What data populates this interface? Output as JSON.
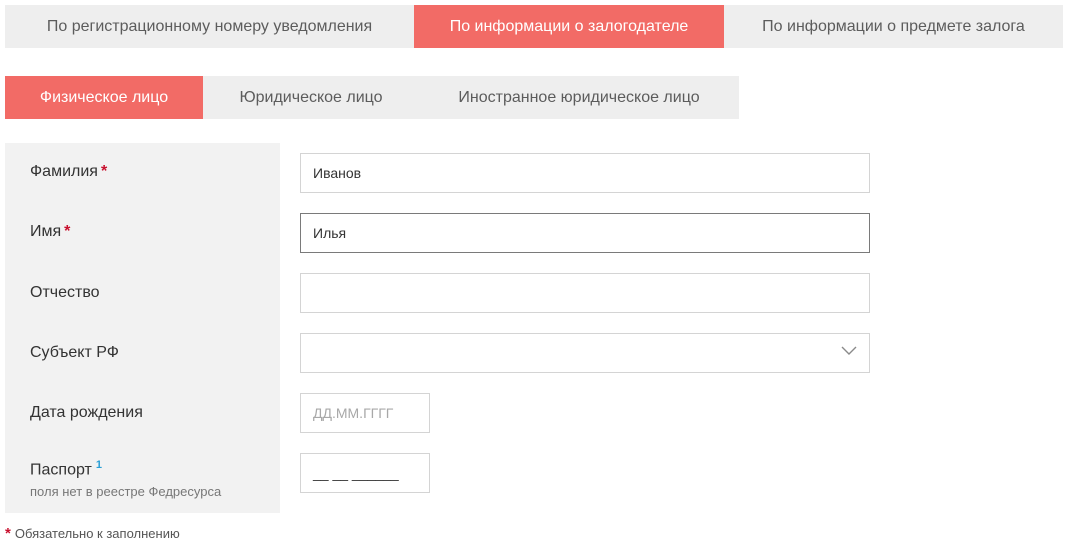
{
  "tabs_top": [
    {
      "label": "По регистрационному номеру уведомления",
      "active": false
    },
    {
      "label": "По информации о залогодателе",
      "active": true
    },
    {
      "label": "По информации о предмете залога",
      "active": false
    }
  ],
  "tabs_sub": [
    {
      "label": "Физическое лицо",
      "active": true
    },
    {
      "label": "Юридическое лицо",
      "active": false
    },
    {
      "label": "Иностранное юридическое лицо",
      "active": false
    }
  ],
  "form": {
    "last_name": {
      "label": "Фамилия",
      "required": "*",
      "value": "Иванов"
    },
    "first_name": {
      "label": "Имя",
      "required": "*",
      "value": "Илья"
    },
    "patronymic": {
      "label": "Отчество",
      "value": ""
    },
    "region": {
      "label": "Субъект РФ",
      "value": ""
    },
    "birth_date": {
      "label": "Дата рождения",
      "placeholder": "ДД.ММ.ГГГГ"
    },
    "passport": {
      "label": "Паспорт",
      "footnote_mark": "1",
      "hint": "поля нет в реестре Федресурса",
      "mask": "__ __ ______"
    }
  },
  "footnote": {
    "star": "*",
    "text": "Обязательно к заполнению"
  },
  "colors": {
    "accent": "#f26b66",
    "tab_bg": "#eeeeee",
    "panel_bg": "#f2f2f2",
    "required": "#c8102e",
    "link": "#2a9fd6"
  },
  "icons": {
    "region_dropdown": "chevron-down-icon"
  }
}
